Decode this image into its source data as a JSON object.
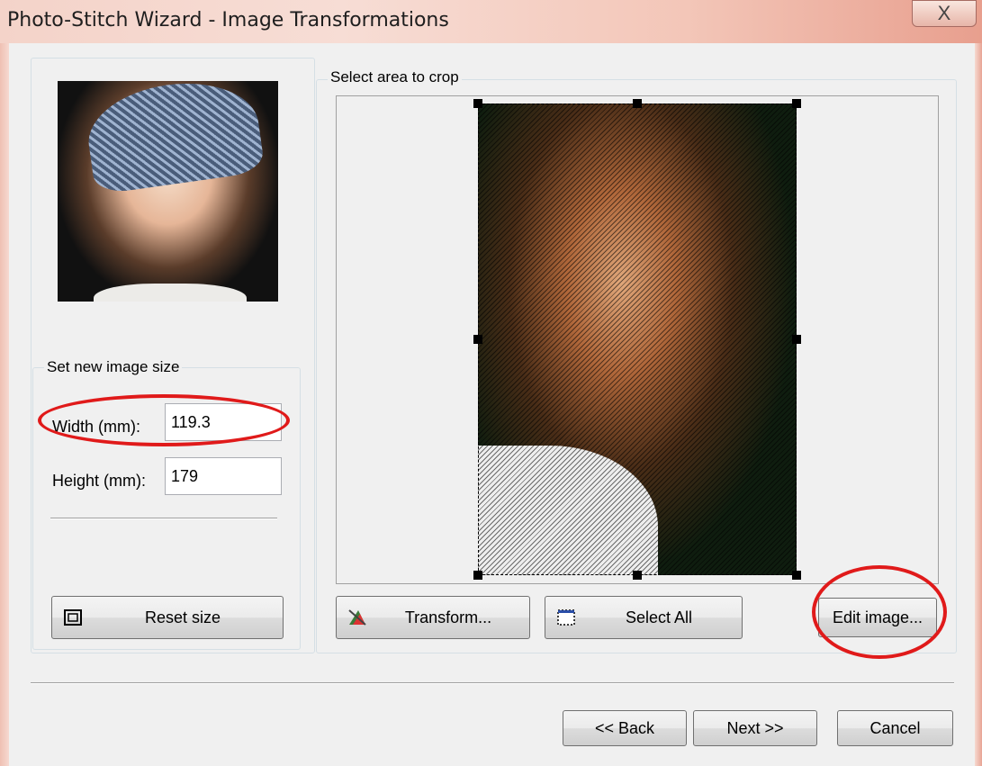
{
  "window": {
    "title": "Photo-Stitch Wizard - Image Transformations",
    "close_glyph": "X"
  },
  "left_panel": {
    "size_group_label": "Set new image size",
    "width_label": "Width (mm):",
    "width_value": "119.3",
    "height_label": "Height (mm):",
    "height_value": "179",
    "reset_button_label": "Reset size"
  },
  "right_panel": {
    "crop_group_label": "Select area to crop",
    "transform_button_label": "Transform...",
    "select_all_button_label": "Select All",
    "edit_image_button_label": "Edit image..."
  },
  "footer": {
    "back_label": "<< Back",
    "next_label": "Next >>",
    "cancel_label": "Cancel"
  },
  "colors": {
    "annotation_circle": "#e01a1a",
    "dialog_background": "#f0f0f0"
  }
}
